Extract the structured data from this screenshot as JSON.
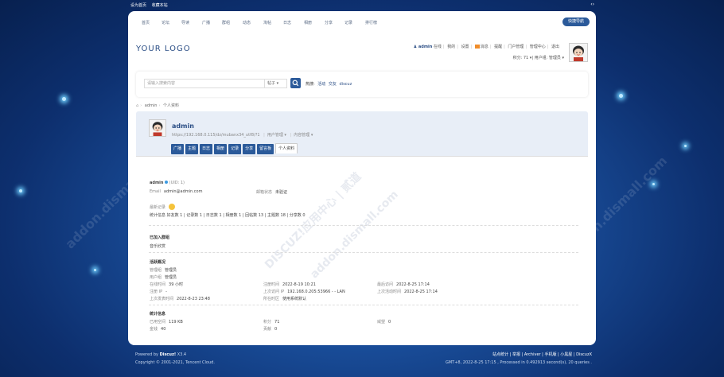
{
  "topbar": {
    "links": [
      "设为首页",
      "收藏本站"
    ]
  },
  "nav": {
    "items": [
      "首页",
      "论坛",
      "导读",
      "广播",
      "群组",
      "动态",
      "淘帖",
      "日志",
      "相册",
      "分享",
      "记录",
      "排行榜"
    ],
    "quick_nav": "快捷导航"
  },
  "header": {
    "logo": "YOUR LOGO",
    "user": "admin",
    "online": "在线",
    "mine": "我的",
    "settings": "设置",
    "messages": "消息",
    "reminder": "提醒",
    "portal_admin": "门户管理",
    "admin_center": "管理中心",
    "logout": "退出",
    "credits": "积分: 71",
    "usergroup": "用户组: 管理员"
  },
  "search": {
    "placeholder": "请输入搜索内容",
    "type": "帖子",
    "hot_label": "热搜:",
    "hot": [
      "活动",
      "交友",
      "discuz"
    ]
  },
  "breadcrumb": {
    "user": "admin",
    "page": "个人资料"
  },
  "profile": {
    "name": "admin",
    "url": "https://192.168.0.115/dz/mubanx34_utf8/?1",
    "user_manage": "用户管理",
    "content_manage": "内容管理",
    "tabs": [
      "广播",
      "主题",
      "日志",
      "相册",
      "记录",
      "分享",
      "留言板",
      "个人资料"
    ]
  },
  "details": {
    "username": "admin",
    "uid": "(UID: 1)",
    "email_label": "Email",
    "email": "admin@admin.com",
    "mail_status_label": "邮箱状态",
    "mail_status": "未验证",
    "recent_record": "最新记录",
    "stats": "统计信息  好友数 1  |  记录数 1  |  日志数 1  |  相册数 1  |  回帖数 13  |  主题数 18  |  分享数 0",
    "joined_groups_title": "已加入群组",
    "joined_groups": "音乐欣赏",
    "activity_title": "活跃概况",
    "admin_group_label": "管理组",
    "admin_group": "管理员",
    "user_group_label": "用户组",
    "user_group": "管理员",
    "online_time_label": "在线时间",
    "online_time": "39 小时",
    "reg_time_label": "注册时间",
    "reg_time": "2022-8-19 10:21",
    "last_visit_label": "最后访问",
    "last_visit": "2022-8-25 17:14",
    "reg_ip_label": "注册 IP",
    "reg_ip": "-",
    "last_ip_label": "上次访问 IP",
    "last_ip": "192.168.0.205:53966 - - LAN",
    "last_active_label": "上次活动时间",
    "last_active": "2022-8-25 17:14",
    "last_post_label": "上次发表时间",
    "last_post": "2022-8-23 23:48",
    "timezone_label": "所在时区",
    "timezone": "使用系统默认",
    "stats_title": "统计信息",
    "space_label": "已用空间",
    "space": "119 KB",
    "credits_label": "积分",
    "credits": "71",
    "prestige_label": "威望",
    "prestige": "0",
    "money_label": "金钱",
    "money": "40",
    "contrib_label": "贡献",
    "contrib": "0"
  },
  "footer": {
    "powered_prefix": "Powered by",
    "powered_brand": "Discuz!",
    "version": "X3.4",
    "copyright": "Copyright © 2001-2021, Tencent Cloud.",
    "links": "站点统计 | 举报 | Archiver | 手机版 | 小黑屋 | DiscuzX",
    "processed": "GMT+8, 2022-8-25 17:15 , Processed in 0.492913 second(s), 20 queries ."
  },
  "watermark": {
    "text": "DISCUZ!应用中心 | 贰道",
    "domain": "addon.dismall.com"
  },
  "colors": {
    "accent": "#2b5a9a",
    "link": "#2c4f86"
  }
}
